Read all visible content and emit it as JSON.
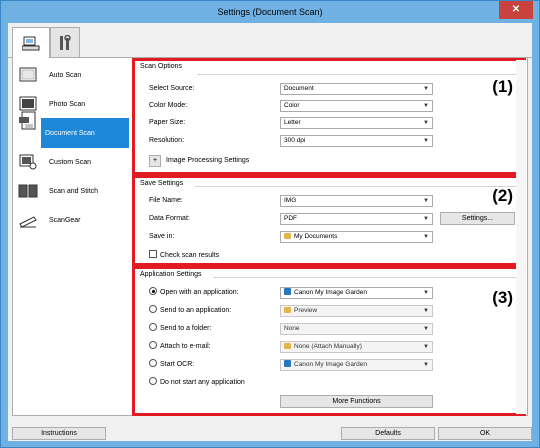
{
  "window": {
    "title": "Settings (Document Scan)",
    "close_glyph": "✕"
  },
  "tabs": [
    {
      "name": "scan-settings-tab",
      "icon": "scanner-pc-icon",
      "active": true
    },
    {
      "name": "general-settings-tab",
      "icon": "tools-icon",
      "active": false
    }
  ],
  "sidebar": {
    "items": [
      {
        "label": "Auto Scan",
        "icon": "auto-scan-icon"
      },
      {
        "label": "Photo Scan",
        "icon": "photo-scan-icon"
      },
      {
        "label": "Document Scan",
        "icon": "document-scan-icon",
        "selected": true
      },
      {
        "label": "Custom Scan",
        "icon": "custom-scan-icon"
      },
      {
        "label": "Scan and Stitch",
        "icon": "scan-stitch-icon"
      },
      {
        "label": "ScanGear",
        "icon": "scangear-icon"
      }
    ]
  },
  "scan_options": {
    "heading": "Scan Options",
    "number": "(1)",
    "source_label": "Select Source:",
    "source_value": "Document",
    "color_label": "Color Mode:",
    "color_value": "Color",
    "paper_label": "Paper Size:",
    "paper_value": "Letter",
    "resolution_label": "Resolution:",
    "resolution_value": "300 dpi",
    "expand_glyph": "+",
    "image_processing_label": "Image Processing Settings"
  },
  "save_settings": {
    "heading": "Save Settings",
    "number": "(2)",
    "filename_label": "File Name:",
    "filename_value": "IMG",
    "format_label": "Data Format:",
    "format_value": "PDF",
    "settings_button": "Settings...",
    "savein_label": "Save in:",
    "savein_value": "My Documents",
    "check_label": "Check scan results"
  },
  "application_settings": {
    "heading": "Application Settings",
    "number": "(3)",
    "open_label": "Open with an application:",
    "open_value": "Canon My Image Garden",
    "send_app_label": "Send to an application:",
    "send_app_value": "Preview",
    "send_folder_label": "Send to a folder:",
    "send_folder_value": "None",
    "email_label": "Attach to e-mail:",
    "email_value": "None (Attach Manually)",
    "ocr_label": "Start OCR:",
    "ocr_value": "Canon My Image Garden",
    "none_label": "Do not start any application",
    "more_button": "More Functions"
  },
  "footer": {
    "instructions": "Instructions",
    "defaults": "Defaults",
    "ok": "OK"
  },
  "colors": {
    "accent_red": "#e21b23",
    "selection_blue": "#1e88d8",
    "title_bar": "#6fb1e3"
  }
}
